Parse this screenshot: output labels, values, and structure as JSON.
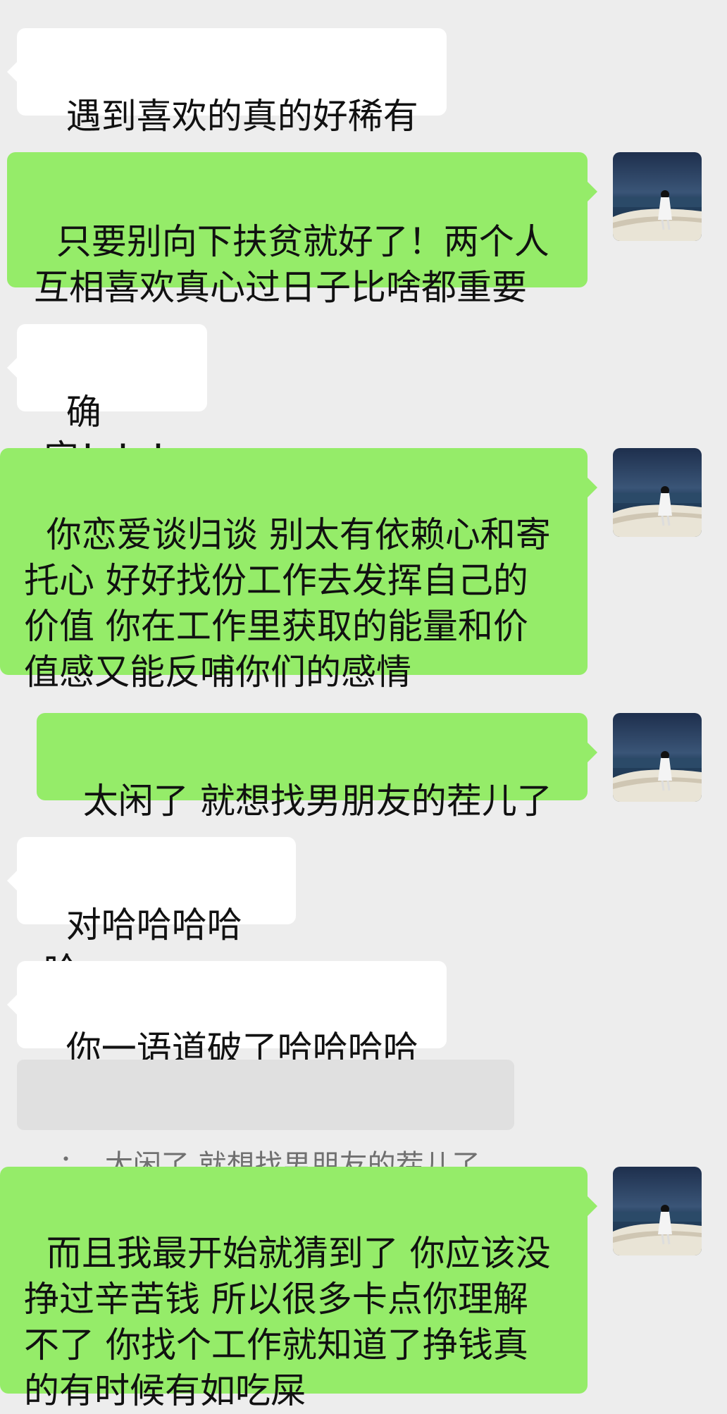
{
  "messages": [
    {
      "side": "in",
      "text": "遇到喜欢的真的好稀有"
    },
    {
      "side": "out",
      "text": "只要别向下扶贫就好了！两个人\n互相喜欢真心过日子比啥都重要"
    },
    {
      "side": "in",
      "text": "确实！！！"
    },
    {
      "side": "out",
      "text": "你恋爱谈归谈 别太有依赖心和寄\n托心 好好找份工作去发挥自己的\n价值 你在工作里获取的能量和价\n值感又能反哺你们的感情"
    },
    {
      "side": "out",
      "text": "太闲了 就想找男朋友的茬儿了"
    },
    {
      "side": "in",
      "text": "对哈哈哈哈哈"
    },
    {
      "side": "in",
      "text": "你一语道破了哈哈哈哈"
    },
    {
      "side": "out",
      "text": "而且我最开始就猜到了 你应该没\n挣过辛苦钱 所以很多卡点你理解\n不了 你找个工作就知道了挣钱真\n的有时候有如吃屎"
    }
  ],
  "quote": {
    "text": "：  太闲了 就想找男朋友的茬儿了"
  },
  "avatar": {
    "icon": "user-avatar-photo-icon"
  },
  "colors": {
    "background": "#ededed",
    "incoming": "#ffffff",
    "outgoing": "#95ec69",
    "quote_bg": "#e0e0e0"
  }
}
